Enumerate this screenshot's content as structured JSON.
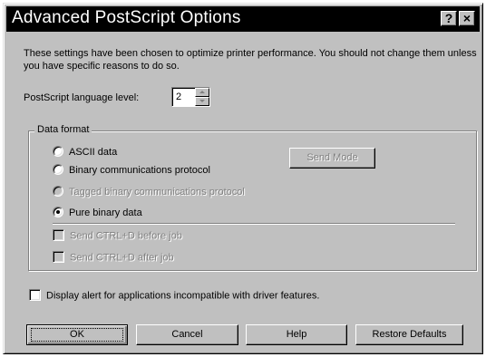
{
  "dialog": {
    "title": "Advanced PostScript Options",
    "help_button": "?",
    "close_button": "×"
  },
  "description": "These settings have been chosen to optimize printer performance. You should not change them unless you have specific reasons to do so.",
  "language_level": {
    "label": "PostScript language level:",
    "value": "2"
  },
  "data_format": {
    "group_label": "Data format",
    "options": [
      {
        "label": "ASCII data",
        "checked": false,
        "enabled": true
      },
      {
        "label": "Binary communications protocol",
        "checked": false,
        "enabled": true
      },
      {
        "label": "Tagged binary communications protocol",
        "checked": false,
        "enabled": false
      },
      {
        "label": "Pure binary data",
        "checked": true,
        "enabled": true
      }
    ],
    "send_mode_button": "Send Mode",
    "checkboxes": [
      {
        "label": "Send CTRL+D before job",
        "checked": false,
        "enabled": false
      },
      {
        "label": "Send CTRL+D after job",
        "checked": false,
        "enabled": false
      }
    ]
  },
  "display_alert": {
    "label": "Display alert for applications incompatible with driver features.",
    "checked": false
  },
  "buttons": {
    "ok": "OK",
    "cancel": "Cancel",
    "help": "Help",
    "restore": "Restore Defaults"
  }
}
